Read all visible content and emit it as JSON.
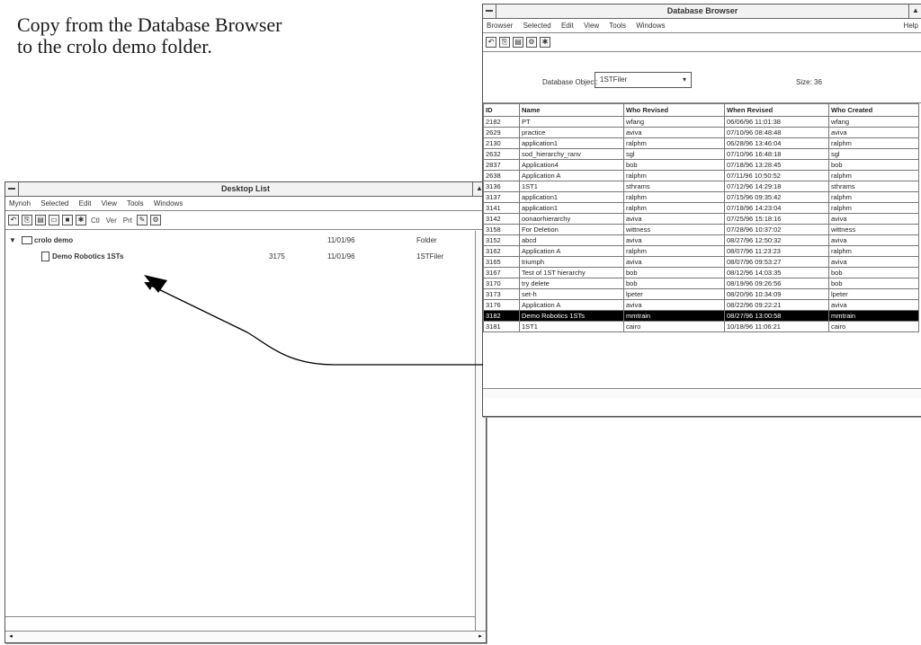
{
  "caption": {
    "line1": "Copy from the Database Browser",
    "line2": "to the crolo demo folder."
  },
  "desktop_window": {
    "title": "Desktop List",
    "menu": [
      "Mynoh",
      "Selected",
      "Edit",
      "View",
      "Tools",
      "Windows"
    ],
    "toolbar_text": [
      "Ctl",
      "Ver",
      "Prt"
    ],
    "folder": {
      "name": "crolo demo",
      "date": "11/01/96",
      "type": "Folder"
    },
    "item": {
      "name": "Demo Robotics 1STs",
      "id": "3175",
      "date": "11/01/96",
      "type": "1STFiler"
    }
  },
  "db_window": {
    "title": "Database Browser",
    "menu": [
      "Browser",
      "Selected",
      "Edit",
      "View",
      "Tools",
      "Windows"
    ],
    "help": "Help",
    "object_label": "Database Object:",
    "object_value": "1STFiler",
    "size_label": "Size: 36",
    "columns": [
      "ID",
      "Name",
      "Who Revised",
      "When Revised",
      "Who Created"
    ],
    "rows": [
      [
        "2182",
        "PT",
        "wfang",
        "06/06/96 11:01:38",
        "wfang"
      ],
      [
        "2629",
        "practice",
        "aviva",
        "07/10/96 08:48:48",
        "aviva"
      ],
      [
        "2130",
        "application1",
        "ralphm",
        "06/28/96 13:46:04",
        "ralphm"
      ],
      [
        "2632",
        "sod_hierarchy_ranv",
        "sgl",
        "07/10/96 16:48:18",
        "sgl"
      ],
      [
        "2837",
        "Application4",
        "bob",
        "07/18/96 13:28:45",
        "bob"
      ],
      [
        "2638",
        "Application A",
        "ralphm",
        "07/11/96 10:50:52",
        "ralphm"
      ],
      [
        "3136",
        "1ST1",
        "sthrams",
        "07/12/96 14:29:18",
        "sthrams"
      ],
      [
        "3137",
        "application1",
        "ralphm",
        "07/15/96 09:35:42",
        "ralphm"
      ],
      [
        "3141",
        "application1",
        "ralphm",
        "07/18/96 14:23:04",
        "ralphm"
      ],
      [
        "3142",
        "oonaorhierarchy",
        "aviva",
        "07/25/96 15:18:16",
        "aviva"
      ],
      [
        "3158",
        "For Deletion",
        "wittness",
        "07/28/96 10:37:02",
        "wittness"
      ],
      [
        "3152",
        "abcd",
        "aviva",
        "08/27/96 12:50:32",
        "aviva"
      ],
      [
        "3162",
        "Application A",
        "ralphm",
        "08/07/96 11:23:23",
        "ralphm"
      ],
      [
        "3165",
        "triumph",
        "aviva",
        "08/07/96 09:53:27",
        "aviva"
      ],
      [
        "3167",
        "Test of 1ST hierarchy",
        "bob",
        "08/12/96 14:03:35",
        "bob"
      ],
      [
        "3170",
        "try delete",
        "bob",
        "08/19/96 09:26:56",
        "bob"
      ],
      [
        "3173",
        "set-h",
        "lpeter",
        "08/20/96 10:34:09",
        "lpeter"
      ],
      [
        "3176",
        "Application A",
        "aviva",
        "08/22/96 09:22:21",
        "aviva"
      ],
      [
        "3182",
        "Demo Robotics 1STs",
        "mmtrain",
        "08/27/96 13:00:58",
        "mmtrain"
      ],
      [
        "3181",
        "1ST1",
        "cairo",
        "10/18/96 11:06:21",
        "cairo"
      ]
    ],
    "selected_row": 18
  }
}
